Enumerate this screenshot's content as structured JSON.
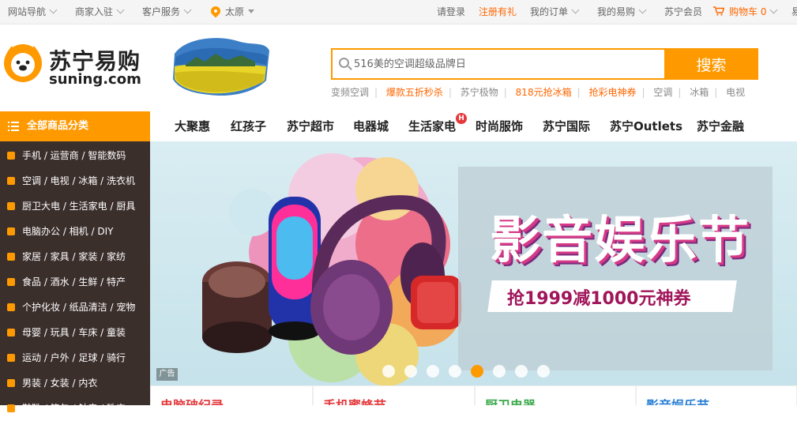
{
  "topbar": {
    "left": [
      {
        "label": "网站导航",
        "dropdown": true
      },
      {
        "label": "商家入驻",
        "dropdown": true
      },
      {
        "label": "客户服务",
        "dropdown": true
      }
    ],
    "location": "太原",
    "right": [
      {
        "label": "请登录"
      },
      {
        "label": "注册有礼",
        "highlight": true
      },
      {
        "label": "我的订单",
        "dropdown": true
      },
      {
        "label": "我的易购",
        "dropdown": true
      },
      {
        "label": "苏宁会员"
      },
      {
        "label": "购物车 0",
        "highlight": true,
        "dropdown": true
      },
      {
        "label": "易"
      }
    ]
  },
  "logo": {
    "cn": "苏宁易购",
    "en": "suning.com"
  },
  "search": {
    "placeholder": "516美的空调超级品牌日",
    "button": "搜索"
  },
  "hotwords": [
    {
      "label": "变频空调",
      "hl": false
    },
    {
      "label": "爆款五折秒杀",
      "hl": true
    },
    {
      "label": "苏宁极物",
      "hl": false
    },
    {
      "label": "818元抢冰箱",
      "hl": true
    },
    {
      "label": "抢彩电神券",
      "hl": true
    },
    {
      "label": "空调",
      "hl": false
    },
    {
      "label": "冰箱",
      "hl": false
    },
    {
      "label": "电视",
      "hl": false
    }
  ],
  "category_head": "全部商品分类",
  "nav": [
    "大聚惠",
    "红孩子",
    "苏宁超市",
    "电器城",
    "生活家电",
    "时尚服饰",
    "苏宁国际",
    "苏宁Outlets",
    "苏宁金融"
  ],
  "nav_badge": "H",
  "sidebar": [
    "手机 / 运营商 / 智能数码",
    "空调 / 电视 / 冰箱 / 洗衣机",
    "厨卫大电 / 生活家电 / 厨具",
    "电脑办公 / 相机 / DIY",
    "家居 / 家具 / 家装 / 家纺",
    "食品 / 酒水 / 生鲜 / 特产",
    "个护化妆 / 纸品清洁 / 宠物",
    "母婴 / 玩具 / 车床 / 童装",
    "运动 / 户外 / 足球 / 骑行",
    "男装 / 女装 / 内衣",
    "鞋靴 / 箱包 / 钟表 / 珠宝"
  ],
  "banner": {
    "headline": "影音娱乐节",
    "slogan": "抢1999减1000元神券",
    "ad_tag": "广告",
    "dots_count": 8,
    "active_dot": 5
  },
  "cards": [
    {
      "label": "电脑破纪录",
      "color": "#e4393c"
    },
    {
      "label": "手机蜜蜂节",
      "color": "#e4393c"
    },
    {
      "label": "厨卫电器",
      "color": "#3aa84a"
    },
    {
      "label": "影音娱乐节",
      "color": "#2a7fd4"
    }
  ],
  "colors": {
    "accent": "#ff9900",
    "sidebar_bg": "#3b2f2c",
    "highlight_text": "#ff6600"
  }
}
